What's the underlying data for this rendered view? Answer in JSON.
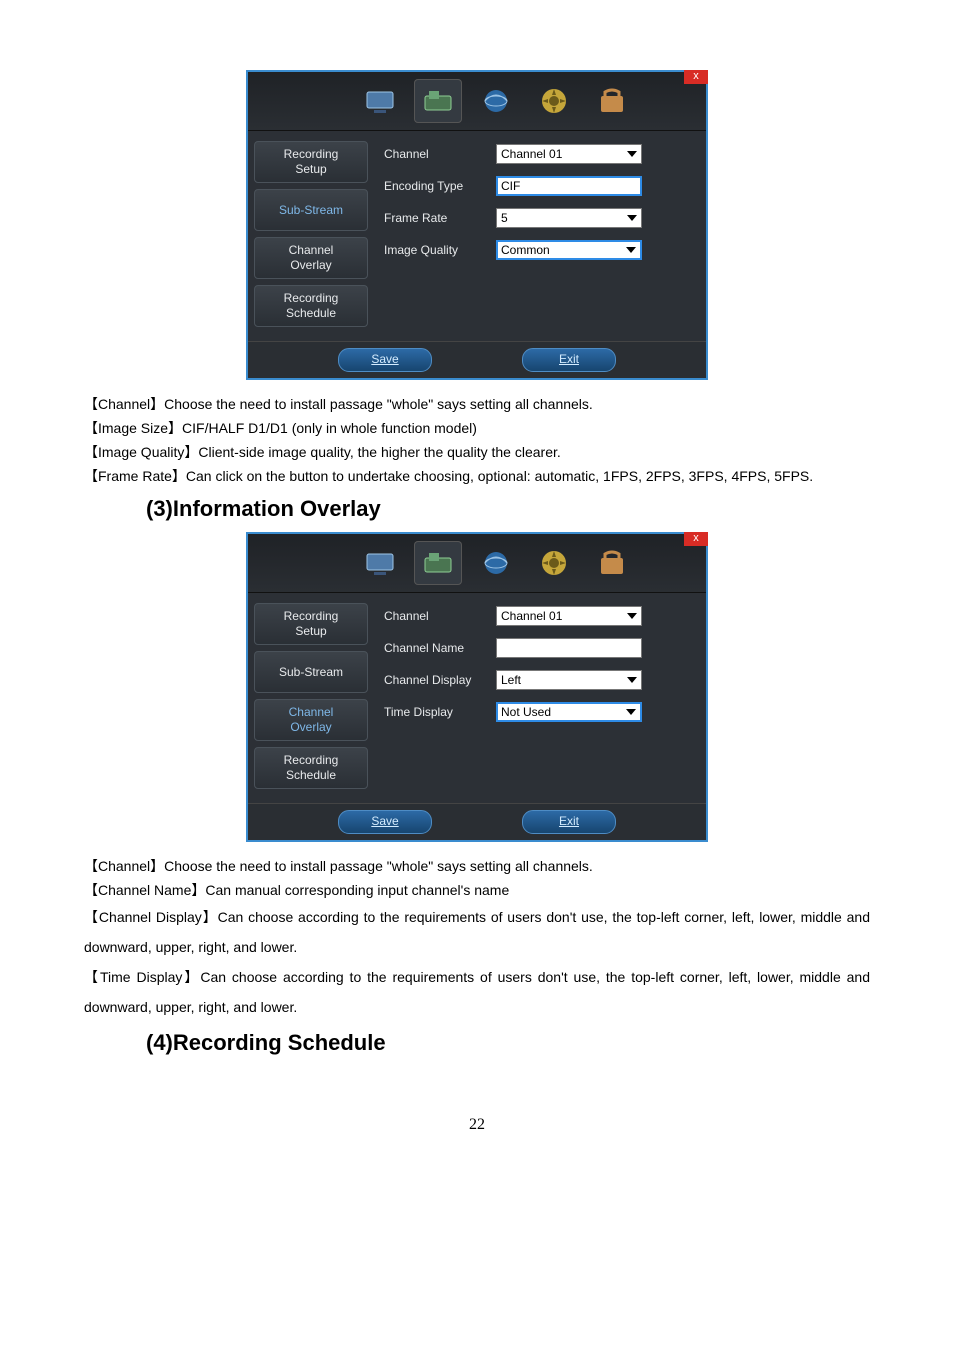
{
  "dialog1": {
    "close": "x",
    "sidebar": {
      "recording_setup": "Recording\nSetup",
      "sub_stream": "Sub-Stream",
      "channel_overlay": "Channel\nOverlay",
      "recording_schedule": "Recording\nSchedule"
    },
    "rows": {
      "channel_label": "Channel",
      "channel_value": "Channel 01",
      "encoding_label": "Encoding Type",
      "encoding_value": "CIF",
      "framerate_label": "Frame Rate",
      "framerate_value": "5",
      "quality_label": "Image Quality",
      "quality_value": "Common"
    },
    "footer": {
      "save": "Save",
      "exit": "Exit"
    }
  },
  "desc1": {
    "channel": "【Channel】Choose the need to install passage \"whole\" says setting all channels.",
    "image_size": "【Image Size】CIF/HALF D1/D1 (only in whole function model)",
    "image_quality": "【Image Quality】Client-side image quality, the higher the quality the clearer.",
    "frame_rate": "【Frame Rate】Can click on the button to undertake choosing, optional: automatic, 1FPS, 2FPS, 3FPS, 4FPS, 5FPS."
  },
  "heading1": "(3)Information Overlay",
  "dialog2": {
    "close": "x",
    "sidebar": {
      "recording_setup": "Recording\nSetup",
      "sub_stream": "Sub-Stream",
      "channel_overlay": "Channel\nOverlay",
      "recording_schedule": "Recording\nSchedule"
    },
    "rows": {
      "channel_label": "Channel",
      "channel_value": "Channel 01",
      "chname_label": "Channel Name",
      "chname_value": "",
      "chdisp_label": "Channel Display",
      "chdisp_value": "Left",
      "timedisp_label": "Time Display",
      "timedisp_value": "Not Used"
    },
    "footer": {
      "save": "Save",
      "exit": "Exit"
    }
  },
  "desc2": {
    "channel": "【Channel】Choose the need to install passage \"whole\" says setting all channels.",
    "channel_name": "【Channel Name】Can manual corresponding input channel's name",
    "channel_display": "【Channel Display】Can choose according to the requirements of users don't use, the top-left corner, left, lower, middle and downward, upper, right, and lower.",
    "time_display": "【Time Display】Can choose according to the requirements of users don't use, the top-left corner, left, lower, middle and downward, upper, right, and lower."
  },
  "heading2": "(4)Recording Schedule",
  "page_number": "22"
}
